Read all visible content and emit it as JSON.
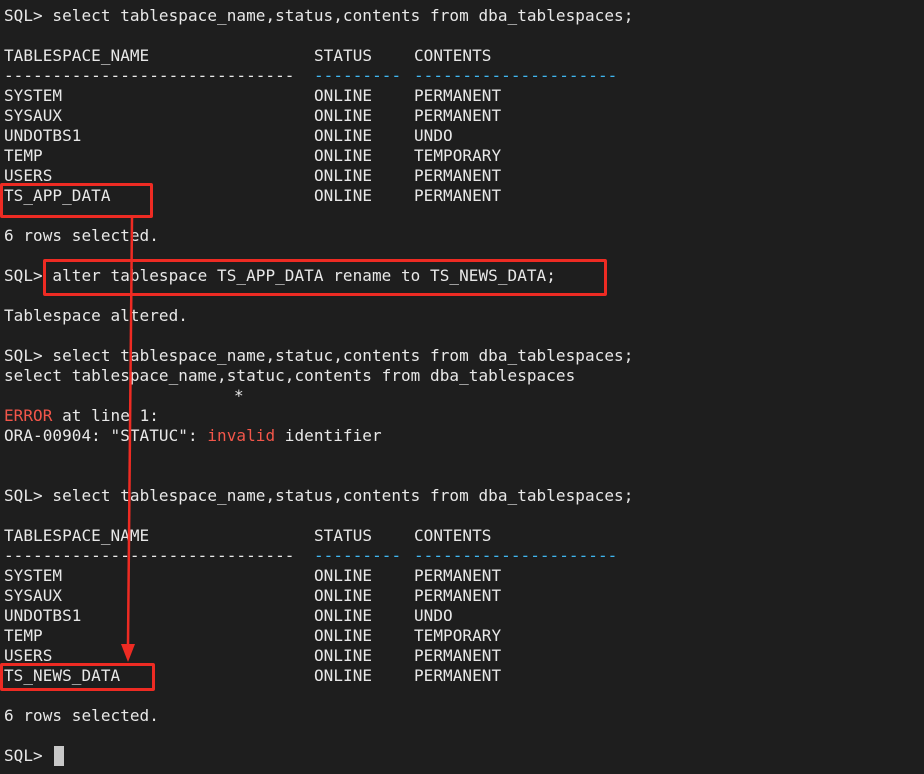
{
  "terminal": {
    "prompt": "SQL>",
    "query1": "select tablespace_name,status,contents from dba_tablespaces;",
    "columns": {
      "name": "TABLESPACE_NAME",
      "status": "STATUS",
      "contents": "CONTENTS"
    },
    "separators": {
      "name": "------------------------------",
      "status": "---------",
      "contents": "---------------------"
    },
    "result1": [
      {
        "name": "SYSTEM",
        "status": "ONLINE",
        "contents": "PERMANENT"
      },
      {
        "name": "SYSAUX",
        "status": "ONLINE",
        "contents": "PERMANENT"
      },
      {
        "name": "UNDOTBS1",
        "status": "ONLINE",
        "contents": "UNDO"
      },
      {
        "name": "TEMP",
        "status": "ONLINE",
        "contents": "TEMPORARY"
      },
      {
        "name": "USERS",
        "status": "ONLINE",
        "contents": "PERMANENT"
      },
      {
        "name": "TS_APP_DATA",
        "status": "ONLINE",
        "contents": "PERMANENT"
      }
    ],
    "rows_selected": "6 rows selected.",
    "alter_cmd": "alter tablespace TS_APP_DATA rename to TS_NEWS_DATA;",
    "altered_msg": "Tablespace altered.",
    "query2": "select tablespace_name,statuc,contents from dba_tablespaces;",
    "echo_query2": "select tablespace_name,statuc,contents from dba_tablespaces",
    "error_marker": "*",
    "error_word": "ERROR",
    "error_rest": " at line 1:",
    "ora_prefix": "ORA-00904: \"STATUC\": ",
    "ora_invalid": "invalid",
    "ora_suffix": " identifier",
    "query3": "select tablespace_name,status,contents from dba_tablespaces;",
    "result2": [
      {
        "name": "SYSTEM",
        "status": "ONLINE",
        "contents": "PERMANENT"
      },
      {
        "name": "SYSAUX",
        "status": "ONLINE",
        "contents": "PERMANENT"
      },
      {
        "name": "UNDOTBS1",
        "status": "ONLINE",
        "contents": "UNDO"
      },
      {
        "name": "TEMP",
        "status": "ONLINE",
        "contents": "TEMPORARY"
      },
      {
        "name": "USERS",
        "status": "ONLINE",
        "contents": "PERMANENT"
      },
      {
        "name": "TS_NEWS_DATA",
        "status": "ONLINE",
        "contents": "PERMANENT"
      }
    ],
    "rows_selected_2": "6 rows selected."
  },
  "colors": {
    "background": "#1e1e1e",
    "text": "#e8e8e8",
    "error": "#f2564a",
    "separator": "#3fb6f0",
    "highlight": "#ee2b23"
  }
}
